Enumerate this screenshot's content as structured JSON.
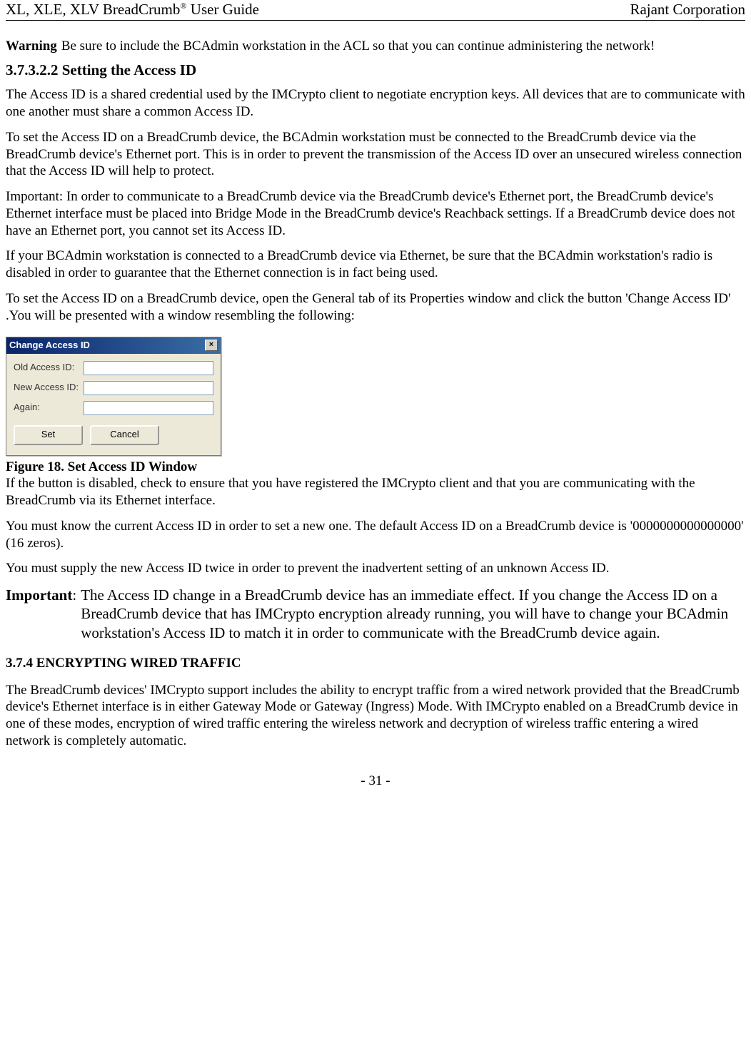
{
  "header": {
    "left_pre": "XL, XLE, XLV BreadCrumb",
    "left_sup": "®",
    "left_post": " User Guide",
    "right": "Rajant Corporation"
  },
  "warning": {
    "label": "Warning",
    "text": "Be sure to include the BCAdmin workstation in the ACL so that you can continue administering the network!"
  },
  "section1": {
    "heading": "3.7.3.2.2 Setting the Access ID",
    "p1": "The Access ID is a shared credential used by the IMCrypto client to negotiate encryption keys. All devices that are to communicate with one another must share a common Access ID.",
    "p2": "To set the Access ID on a BreadCrumb device, the BCAdmin workstation must be connected to the BreadCrumb device via the BreadCrumb device's Ethernet port. This is in order to prevent the transmission of the Access ID over an unsecured wireless connection that the Access ID will help to protect.",
    "p3": "Important: In order to communicate to a BreadCrumb device via the BreadCrumb device's Ethernet port, the BreadCrumb device's Ethernet interface must be placed into Bridge Mode in the BreadCrumb device's Reachback settings. If a BreadCrumb device does not have an Ethernet port, you cannot set its Access ID.",
    "p4": "If your BCAdmin workstation is connected to a BreadCrumb device via Ethernet, be sure that the BCAdmin workstation's radio is disabled in order to guarantee that the Ethernet connection is in fact being used.",
    "p5": "To set the Access ID on a BreadCrumb device, open the General tab of its Properties window and click the button 'Change Access ID' .You will be presented with a window resembling the following:"
  },
  "dialog": {
    "title": "Change Access ID",
    "close": "×",
    "row1": "Old Access ID:",
    "row2": "New Access ID:",
    "row3": "Again:",
    "btn_set": "Set",
    "btn_cancel": "Cancel"
  },
  "figure_caption": "Figure 18. Set Access ID Window",
  "after_fig": {
    "p1": "If the button is disabled, check to ensure that you have registered the IMCrypto client and that you are communicating with the BreadCrumb via its Ethernet interface.",
    "p2": "You must know the current Access ID in order to set a new one. The default Access ID on a BreadCrumb device is '0000000000000000' (16 zeros).",
    "p3": "You must supply the new Access ID twice in order to prevent the inadvertent setting of an unknown Access ID."
  },
  "important": {
    "label": "Important",
    "colon": ":",
    "text": "The Access ID change in a BreadCrumb device has an immediate effect. If you change the Access ID on a BreadCrumb device that has IMCrypto encryption already running, you will have to change your BCAdmin workstation's Access ID to match it in order to communicate with the BreadCrumb device again."
  },
  "section2": {
    "heading": "3.7.4 ENCRYPTING WIRED TRAFFIC",
    "p1": "The BreadCrumb devices' IMCrypto support includes the ability to encrypt traffic from a wired network provided that the BreadCrumb device's Ethernet interface is in either Gateway Mode or Gateway (Ingress) Mode. With IMCrypto enabled on a BreadCrumb device in one of these modes, encryption of wired traffic entering the wireless network and decryption of wireless traffic entering a wired network is completely automatic."
  },
  "footer": "- 31 -"
}
